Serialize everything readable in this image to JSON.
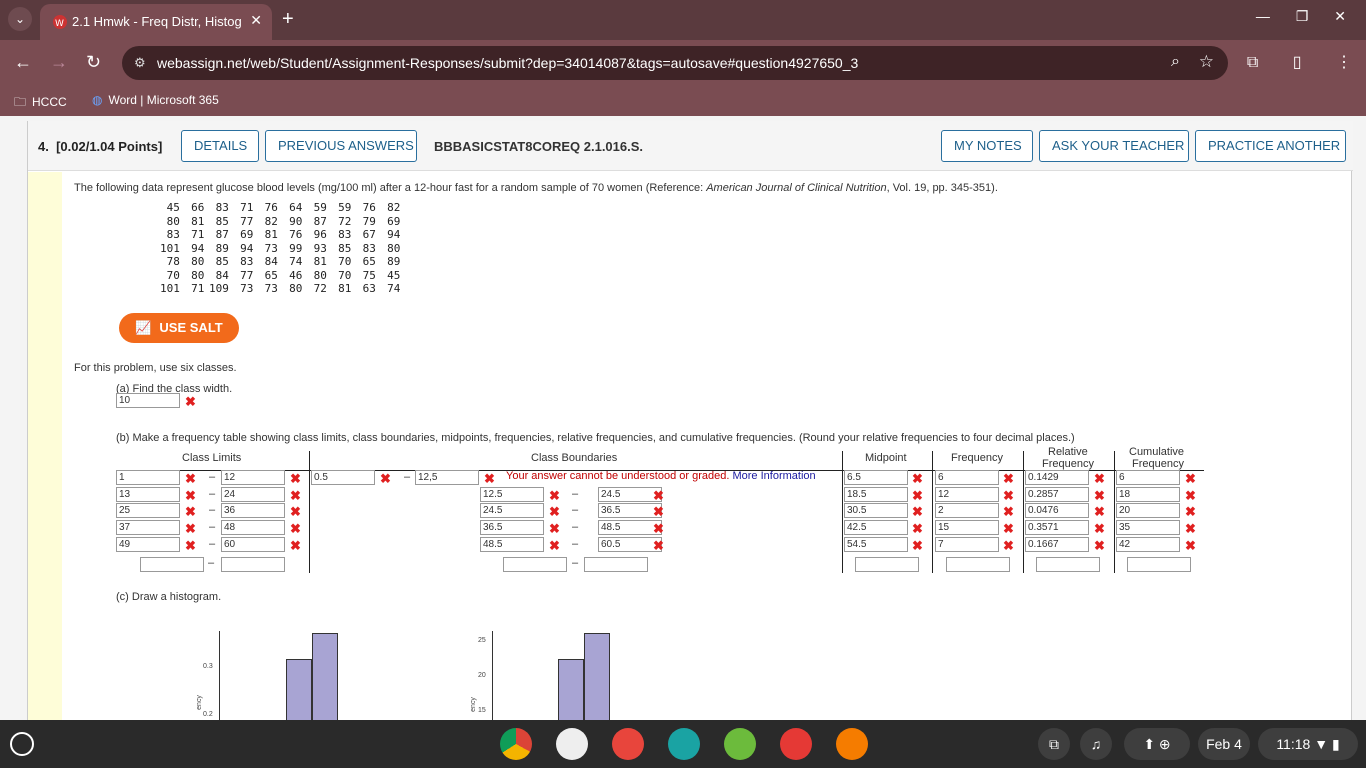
{
  "browser": {
    "tab_title": "2.1 Hmwk - Freq Distr, Histogra",
    "url": "webassign.net/web/Student/Assignment-Responses/submit?dep=34014087&tags=autosave#question4927650_3",
    "bookmarks": [
      "HCCC",
      "Word | Microsoft 365"
    ]
  },
  "question": {
    "number": "4.",
    "points": "[0.02/1.04 Points]",
    "details_label": "DETAILS",
    "previous_answers_label": "PREVIOUS ANSWERS",
    "code": "BBBASICSTAT8COREQ 2.1.016.S.",
    "my_notes_label": "MY NOTES",
    "ask_teacher_label": "ASK YOUR TEACHER",
    "practice_another_label": "PRACTICE ANOTHER",
    "intro_pre": "The following data represent glucose blood levels (mg/100 ml) after a 12-hour fast for a random sample of 70 women (Reference: ",
    "intro_ref": "American Journal of Clinical Nutrition",
    "intro_post": ", Vol. 19, pp. 345-351).",
    "data_rows": [
      [
        "45",
        "66",
        "83",
        "71",
        "76",
        "64",
        "59",
        "59",
        "76",
        "82"
      ],
      [
        "80",
        "81",
        "85",
        "77",
        "82",
        "90",
        "87",
        "72",
        "79",
        "69"
      ],
      [
        "83",
        "71",
        "87",
        "69",
        "81",
        "76",
        "96",
        "83",
        "67",
        "94"
      ],
      [
        "101",
        "94",
        "89",
        "94",
        "73",
        "99",
        "93",
        "85",
        "83",
        "80"
      ],
      [
        "78",
        "80",
        "85",
        "83",
        "84",
        "74",
        "81",
        "70",
        "65",
        "89"
      ],
      [
        "70",
        "80",
        "84",
        "77",
        "65",
        "46",
        "80",
        "70",
        "75",
        "45"
      ],
      [
        "101",
        "71",
        "109",
        "73",
        "73",
        "80",
        "72",
        "81",
        "63",
        "74"
      ]
    ],
    "salt_label": "USE SALT",
    "instruction": "For this problem, use six classes.",
    "part_a": "(a) Find the class width.",
    "class_width": "10",
    "part_b": "(b) Make a frequency table showing class limits, class boundaries, midpoints, frequencies, relative frequencies, and cumulative frequencies. (Round your relative frequencies to four decimal places.)",
    "headers": {
      "class_limits": "Class Limits",
      "class_boundaries": "Class Boundaries",
      "midpoint": "Midpoint",
      "frequency": "Frequency",
      "rel_freq_1": "Relative",
      "rel_freq_2": "Frequency",
      "cum_freq_1": "Cumulative",
      "cum_freq_2": "Frequency"
    },
    "rows": [
      {
        "lo": "1",
        "hi": "12",
        "blo": "0.5",
        "bhi": "12,5",
        "mid": "6.5",
        "freq": "6",
        "rel": "0.1429",
        "cum": "6"
      },
      {
        "lo": "13",
        "hi": "24",
        "blo": "12.5",
        "bhi": "24.5",
        "mid": "18.5",
        "freq": "12",
        "rel": "0.2857",
        "cum": "18"
      },
      {
        "lo": "25",
        "hi": "36",
        "blo": "24.5",
        "bhi": "36.5",
        "mid": "30.5",
        "freq": "2",
        "rel": "0.0476",
        "cum": "20"
      },
      {
        "lo": "37",
        "hi": "48",
        "blo": "36.5",
        "bhi": "48.5",
        "mid": "42.5",
        "freq": "15",
        "rel": "0.3571",
        "cum": "35"
      },
      {
        "lo": "49",
        "hi": "60",
        "blo": "48.5",
        "bhi": "60.5",
        "mid": "54.5",
        "freq": "7",
        "rel": "0.1667",
        "cum": "42"
      }
    ],
    "error_text": "Your answer cannot be understood or graded.",
    "more_info": "More Information",
    "dash": "–",
    "part_c": "(c) Draw a histogram.",
    "hist1_ticks": [
      "0.3",
      "0.2"
    ],
    "hist1_ylabel": "ency",
    "hist2_ticks": [
      "25",
      "20",
      "15"
    ],
    "hist2_ylabel": "ency"
  },
  "taskbar": {
    "date": "Feb 4",
    "time": "11:18"
  }
}
